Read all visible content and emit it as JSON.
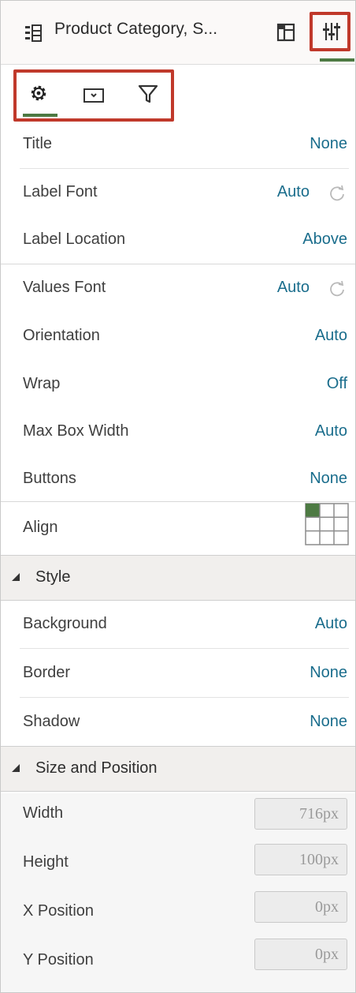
{
  "header": {
    "title": "Product Category, S...",
    "list_icon": "filter-list-icon",
    "layout_icon": "layout-panel-icon",
    "properties_icon": "sliders-icon"
  },
  "tabs": [
    {
      "icon": "gear-icon",
      "active": true
    },
    {
      "icon": "dropdown-box-icon",
      "active": false
    },
    {
      "icon": "filter-icon",
      "active": false
    }
  ],
  "properties": {
    "title": {
      "label": "Title",
      "value": "None"
    },
    "label_font": {
      "label": "Label Font",
      "value": "Auto"
    },
    "label_location": {
      "label": "Label Location",
      "value": "Above"
    },
    "values_font": {
      "label": "Values Font",
      "value": "Auto"
    },
    "orientation": {
      "label": "Orientation",
      "value": "Auto"
    },
    "wrap": {
      "label": "Wrap",
      "value": "Off"
    },
    "max_box_width": {
      "label": "Max Box Width",
      "value": "Auto"
    },
    "buttons": {
      "label": "Buttons",
      "value": "None"
    },
    "align": {
      "label": "Align"
    }
  },
  "style": {
    "section_title": "Style",
    "background": {
      "label": "Background",
      "value": "Auto"
    },
    "border": {
      "label": "Border",
      "value": "None"
    },
    "shadow": {
      "label": "Shadow",
      "value": "None"
    }
  },
  "size_position": {
    "section_title": "Size and Position",
    "width": {
      "label": "Width",
      "value": "716px"
    },
    "height": {
      "label": "Height",
      "value": "100px"
    },
    "x_position": {
      "label": "X Position",
      "value": "0px"
    },
    "y_position": {
      "label": "Y Position",
      "value": "0px"
    }
  },
  "colors": {
    "accent": "#4d7a43",
    "value_link": "#1a6d8c",
    "highlight_box": "#c0392b"
  }
}
